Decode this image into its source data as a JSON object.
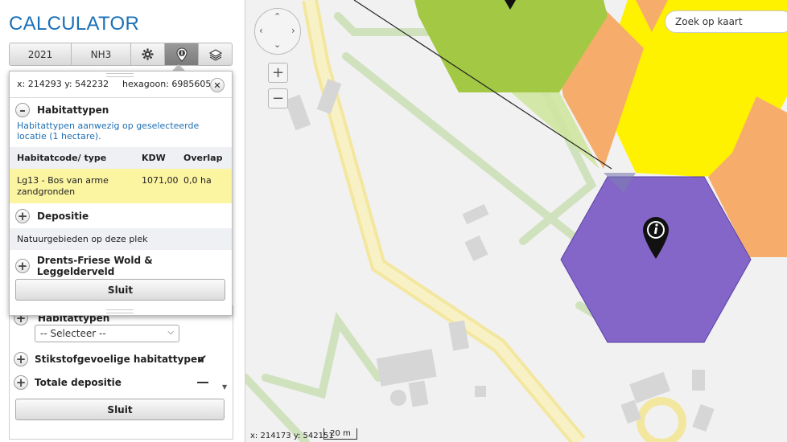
{
  "app": {
    "title": "CALCULATOR"
  },
  "tabs": [
    {
      "label": "2021"
    },
    {
      "label": "NH3"
    },
    {
      "label": "",
      "icon": "gear-icon"
    },
    {
      "label": "",
      "icon": "info-pin-icon",
      "active": true
    },
    {
      "label": "",
      "icon": "layers-icon"
    }
  ],
  "back_panel": {
    "habitattypen_label": "Habitattypen",
    "select_value": "-- Selecteer --",
    "stikstof_label": "Stikstofgevoelige habitattypen",
    "totale_label": "Totale depositie",
    "close_label": "Sluit"
  },
  "popup": {
    "coords": "x: 214293 y: 542232",
    "hexagon": "hexagoon: 6985605",
    "habitat_section": "Habitattypen",
    "habitat_desc": "Habitattypen aanwezig op geselecteerde locatie (1 hectare).",
    "table": {
      "headers": [
        "Habitatcode/ type",
        "KDW",
        "Overlap"
      ],
      "rows": [
        {
          "type": "Lg13 - Bos van arme zandgronden",
          "kdw": "1071,00",
          "overlap": "0,0 ha"
        }
      ]
    },
    "depositie_section": "Depositie",
    "natuur_label": "Natuurgebieden op deze plek",
    "area_section": "Drents-Friese Wold & Leggelderveld",
    "close_label": "Sluit"
  },
  "map": {
    "search_placeholder": "Zoek op kaart",
    "zoom_in": "+",
    "zoom_out": "−",
    "cursor_coords": "x: 214173 y: 542151",
    "scale_label": "20 m",
    "colors": {
      "hex_selected": "#8466c8",
      "hex_green": "#a3c944",
      "hex_orange": "#f6ad6b",
      "hex_yellow": "#fff200",
      "road": "#f5eaa0",
      "path_green": "#c9dfb4",
      "building": "#d4d4d4"
    }
  }
}
